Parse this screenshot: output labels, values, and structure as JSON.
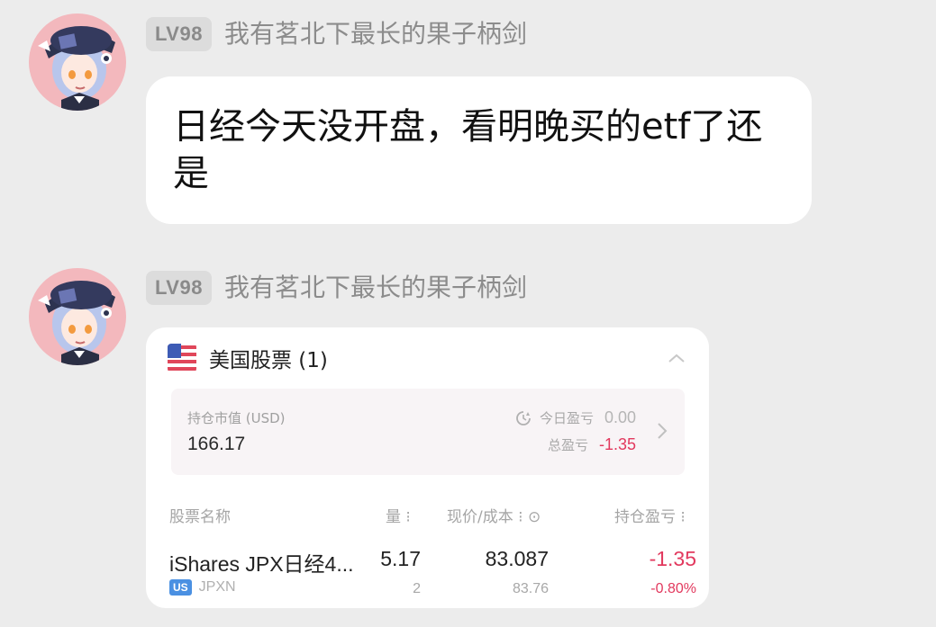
{
  "messages": [
    {
      "level": "LV98",
      "nickname": "我有茗北下最长的果子柄剑",
      "text": "日经今天没开盘，看明晚买的etf了还是"
    },
    {
      "level": "LV98",
      "nickname": "我有茗北下最长的果子柄剑",
      "card": {
        "title": "美国股票 (1)",
        "flag_icon": "us-flag-icon",
        "summary": {
          "market_value_label": "持仓市值 (USD)",
          "market_value": "166.17",
          "today_pl_label": "今日盈亏",
          "today_pl": "0.00",
          "total_pl_label": "总盈亏",
          "total_pl": "-1.35"
        },
        "columns": {
          "name": "股票名称",
          "qty": "量 ⁝",
          "price": "现价/成本 ⁝ ⊙",
          "pl": "持仓盈亏 ⁝"
        },
        "rows": [
          {
            "name": "iShares JPX日经4...",
            "market": "US",
            "ticker": "JPXN",
            "value_partial": "5.17",
            "qty": "2",
            "price": "83.087",
            "cost": "83.76",
            "pl": "-1.35",
            "pl_pct": "-0.80%"
          }
        ]
      }
    }
  ],
  "colors": {
    "background": "#ececec",
    "bubble": "#ffffff",
    "loss_red": "#e2395e",
    "market_badge": "#4a90e2"
  }
}
